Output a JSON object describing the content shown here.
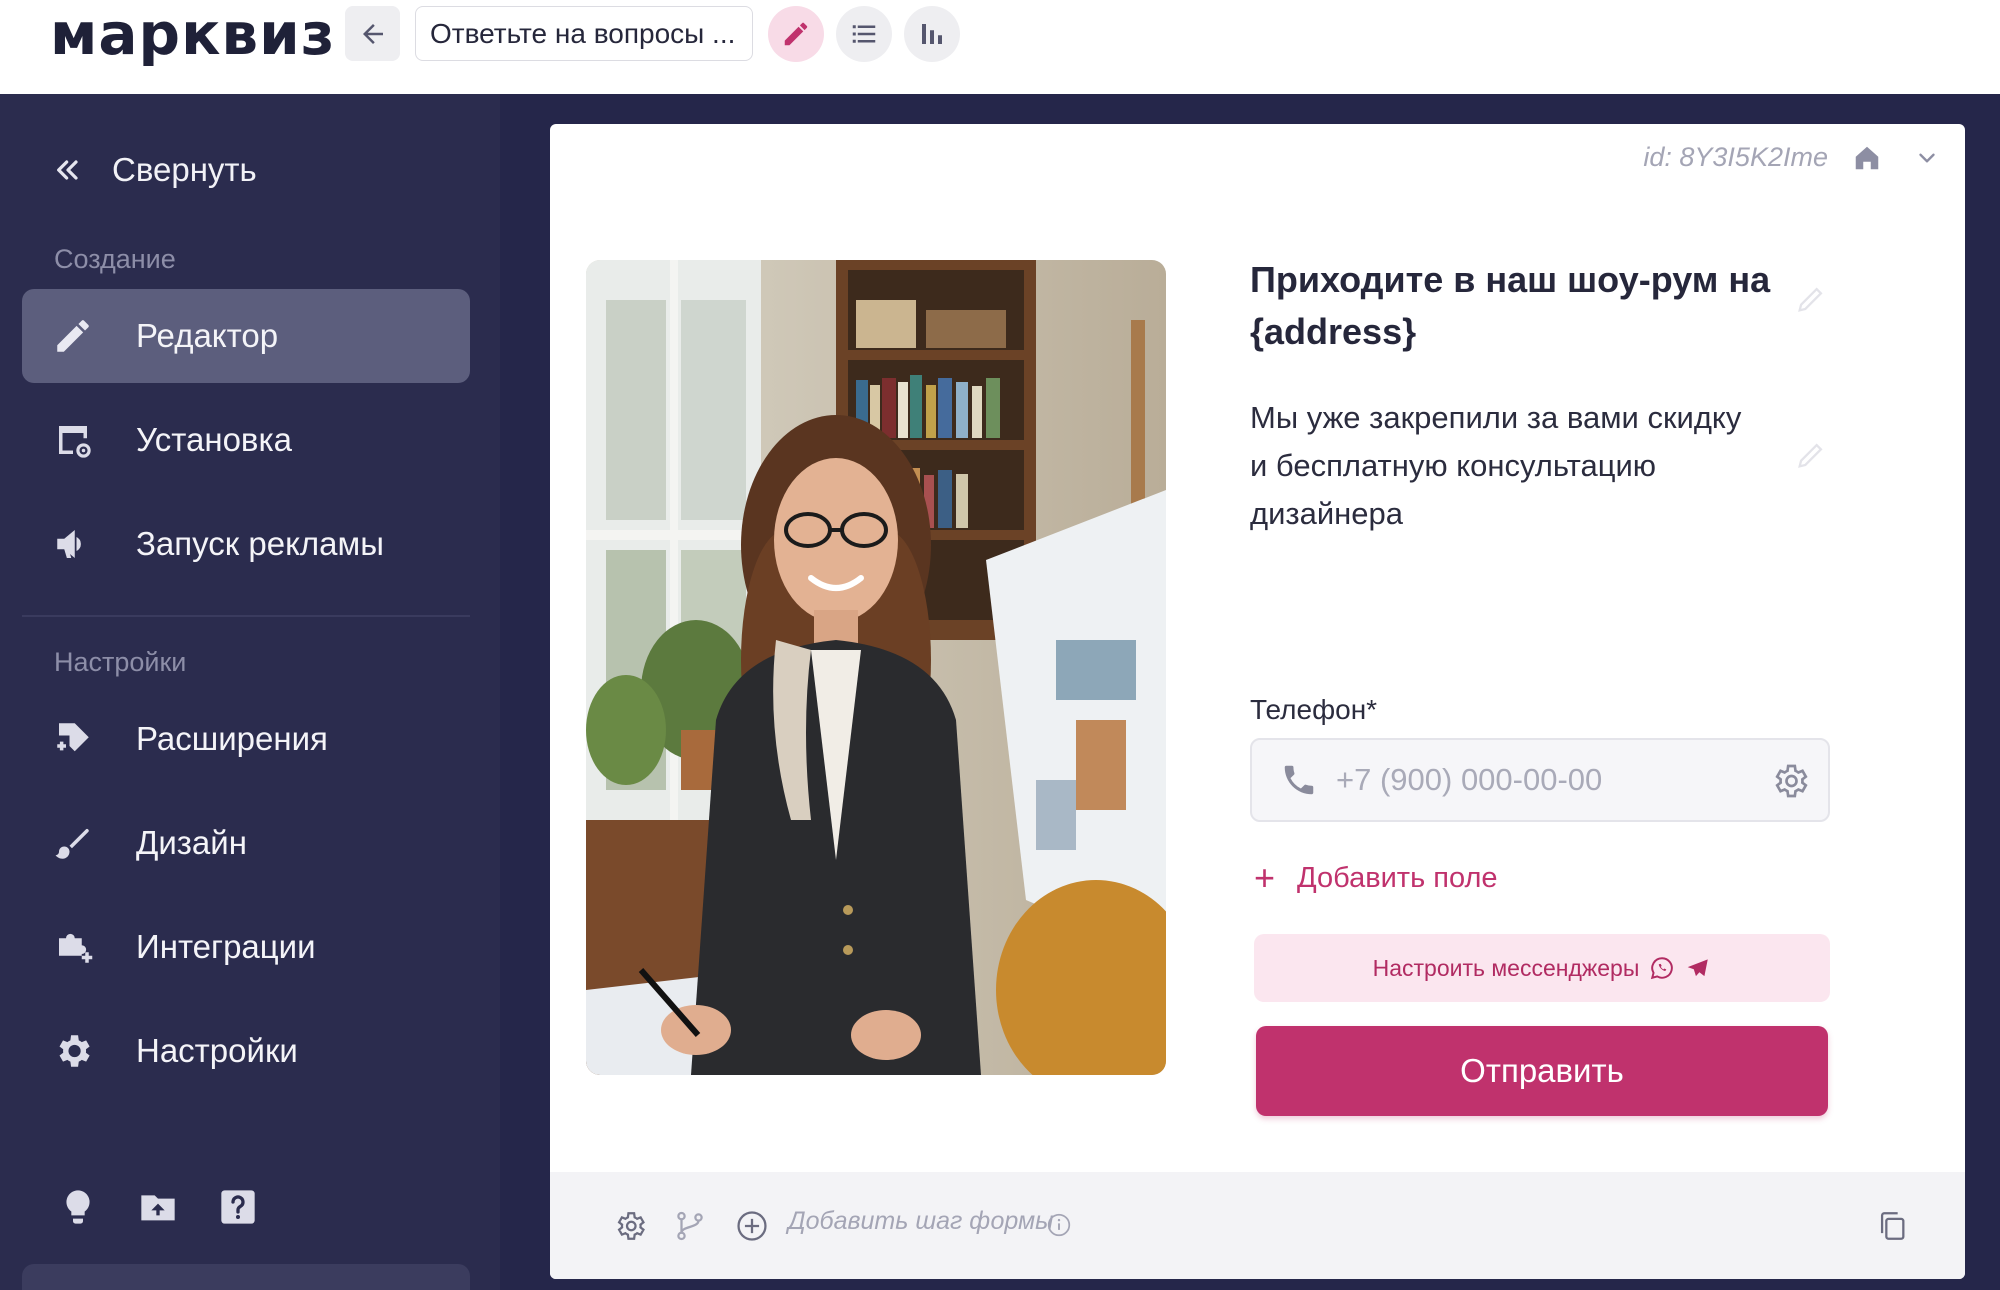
{
  "app": {
    "logo": "марквиз",
    "quiz_title": "Ответьте на вопросы ..."
  },
  "toolbar": {
    "back_icon": "arrow-left-icon",
    "edit_icon": "pencil-icon",
    "list_icon": "list-icon",
    "stats_icon": "bar-chart-icon",
    "accent_color": "#c0326d"
  },
  "sidebar": {
    "collapse_label": "Свернуть",
    "section_create": "Создание",
    "section_settings": "Настройки",
    "items": [
      {
        "label": "Редактор",
        "icon": "pencil-icon",
        "active": true
      },
      {
        "label": "Установка",
        "icon": "install-icon",
        "active": false
      },
      {
        "label": "Запуск рекламы",
        "icon": "megaphone-icon",
        "active": false
      },
      {
        "label": "Расширения",
        "icon": "tag-plus-icon",
        "active": false
      },
      {
        "label": "Дизайн",
        "icon": "brush-icon",
        "active": false
      },
      {
        "label": "Интеграции",
        "icon": "puzzle-icon",
        "active": false
      },
      {
        "label": "Настройки",
        "icon": "gear-icon",
        "active": false
      }
    ],
    "bottom_icons": [
      "lightbulb-icon",
      "folder-upload-icon",
      "help-icon"
    ],
    "bg_color": "#2b2c4e",
    "active_color": "#5c5e7d"
  },
  "card": {
    "id_text": "id: 8Y3I5K2Ime",
    "title": "Приходите в наш шоу-рум на {address}",
    "description": "Мы уже закрепили за вами скидку и бесплатную консультацию дизайнера",
    "phone_label": "Телефон*",
    "phone_placeholder": "+7 (900) 000-00-00",
    "add_field_label": "Добавить поле",
    "messengers_label": "Настроить мессенджеры",
    "submit_label": "Отправить"
  },
  "footer": {
    "add_step_label": "Добавить шаг формы"
  }
}
